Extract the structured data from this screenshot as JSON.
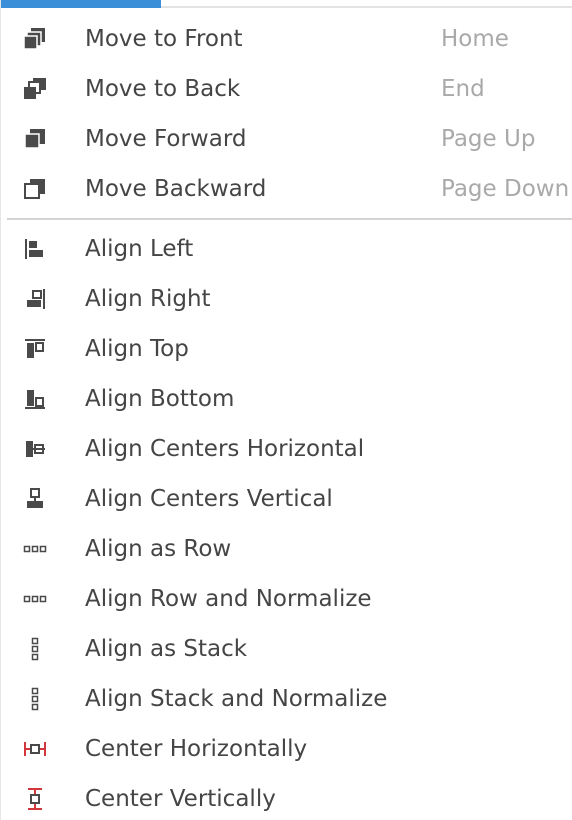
{
  "colors": {
    "accent": "#3b8fd9",
    "icon": "#4a4a4a",
    "icon_red": "#d2383b",
    "label": "#454545",
    "shortcut": "#a9a9a9"
  },
  "arrange_items": [
    {
      "label": "Move to Front",
      "shortcut": "Home",
      "icon": "move-to-front-icon"
    },
    {
      "label": "Move to Back",
      "shortcut": "End",
      "icon": "move-to-back-icon"
    },
    {
      "label": "Move Forward",
      "shortcut": "Page Up",
      "icon": "move-forward-icon"
    },
    {
      "label": "Move Backward",
      "shortcut": "Page Down",
      "icon": "move-backward-icon"
    }
  ],
  "align_items": [
    {
      "label": "Align Left",
      "icon": "align-left-icon"
    },
    {
      "label": "Align Right",
      "icon": "align-right-icon"
    },
    {
      "label": "Align Top",
      "icon": "align-top-icon"
    },
    {
      "label": "Align Bottom",
      "icon": "align-bottom-icon"
    },
    {
      "label": "Align Centers Horizontal",
      "icon": "align-centers-horizontal-icon"
    },
    {
      "label": "Align Centers Vertical",
      "icon": "align-centers-vertical-icon"
    },
    {
      "label": "Align as Row",
      "icon": "align-as-row-icon"
    },
    {
      "label": "Align Row and Normalize",
      "icon": "align-row-normalize-icon"
    },
    {
      "label": "Align as Stack",
      "icon": "align-as-stack-icon"
    },
    {
      "label": "Align Stack and Normalize",
      "icon": "align-stack-normalize-icon"
    },
    {
      "label": "Center Horizontally",
      "icon": "center-horizontally-icon"
    },
    {
      "label": "Center Vertically",
      "icon": "center-vertically-icon"
    }
  ]
}
